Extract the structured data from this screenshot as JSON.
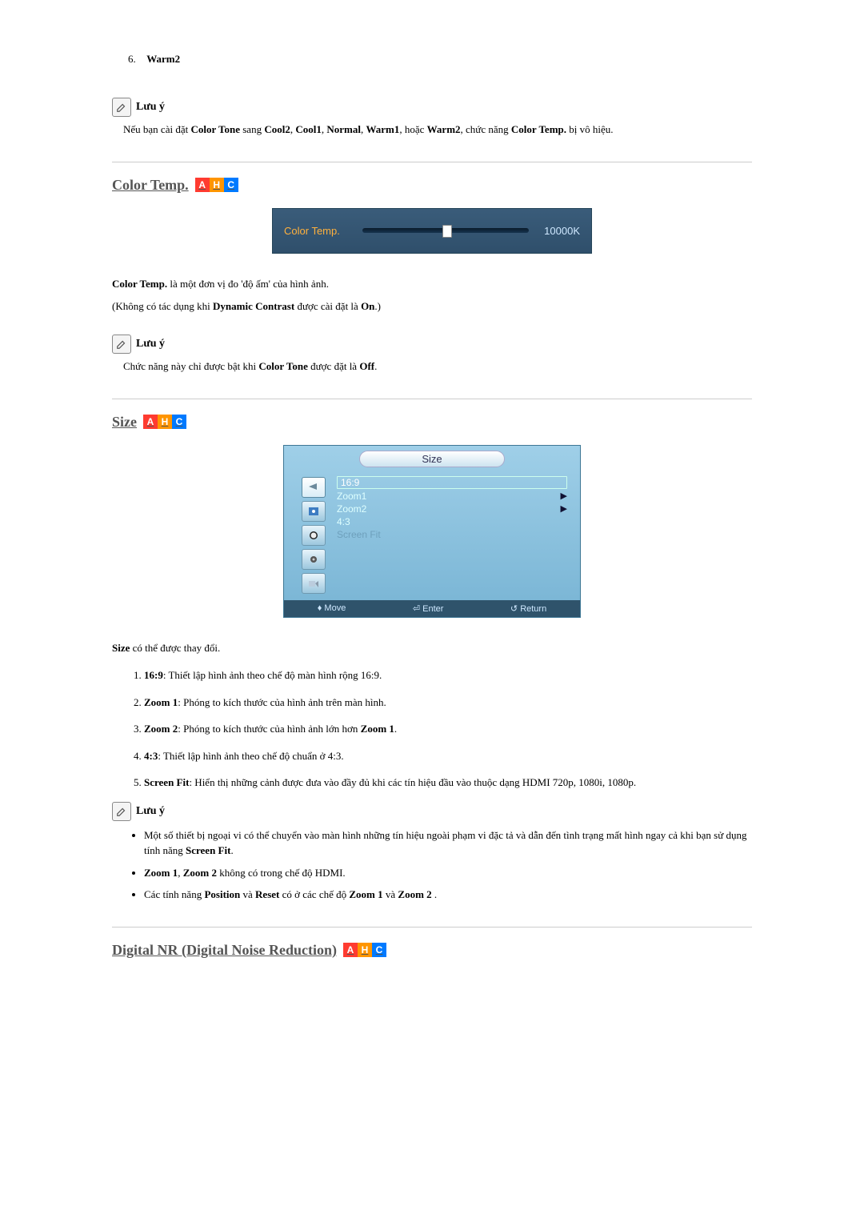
{
  "item6": {
    "number": "6.",
    "label": "Warm2"
  },
  "note_label": "Lưu ý",
  "note1_prefix": "Nếu bạn cài đặt ",
  "note1_b1": "Color Tone",
  "note1_mid1": " sang ",
  "note1_b2": "Cool2",
  "note1_c1": ", ",
  "note1_b3": "Cool1",
  "note1_c2": ", ",
  "note1_b4": "Normal",
  "note1_c3": ", ",
  "note1_b5": "Warm1",
  "note1_c4": ", hoặc ",
  "note1_b6": "Warm2",
  "note1_c5": ", chức năng ",
  "note1_b7": "Color Temp.",
  "note1_suffix": " bị vô hiệu.",
  "sec_colortemp": "Color Temp.",
  "badges": {
    "a": "A",
    "h": "H",
    "c": "C"
  },
  "slider": {
    "label": "Color Temp.",
    "value": "10000K"
  },
  "ct_desc_b": "Color Temp.",
  "ct_desc_t": " là một đơn vị đo 'độ ấm' của hình ảnh.",
  "ct_paren_a": "(Không có tác dụng khi ",
  "ct_paren_b1": "Dynamic Contrast",
  "ct_paren_m": " được cài đặt là ",
  "ct_paren_b2": "On",
  "ct_paren_z": ".)",
  "note2_a": "Chức năng này chỉ được bật khi ",
  "note2_b1": "Color Tone",
  "note2_m": " được đặt là ",
  "note2_b2": "Off",
  "note2_z": ".",
  "sec_size": "Size",
  "osd": {
    "tab": "Size",
    "rows": [
      "16:9",
      "Zoom1",
      "Zoom2",
      "4:3",
      "Screen Fit"
    ],
    "footer": {
      "move": "Move",
      "enter": "Enter",
      "return": "Return"
    }
  },
  "size_desc_b": "Size",
  "size_desc_t": " có thể được thay đổi.",
  "size_items": [
    {
      "b": "16:9",
      "t": ": Thiết lập hình ảnh theo chế độ màn hình rộng 16:9."
    },
    {
      "b": "Zoom 1",
      "t": ": Phóng to kích thước của hình ảnh trên màn hình."
    },
    {
      "b": "Zoom 2",
      "t": ": Phóng to kích thước của hình ảnh lớn hơn ",
      "b2": "Zoom 1",
      "t2": "."
    },
    {
      "b": "4:3",
      "t": ": Thiết lập hình ảnh theo chế độ chuẩn ở 4:3."
    },
    {
      "b": "Screen Fit",
      "t": ": Hiển thị những cảnh được đưa vào đầy đủ khi các tín hiệu đầu vào thuộc dạng HDMI 720p, 1080i, 1080p."
    }
  ],
  "note3_bullet1_a": "Một số thiết bị ngoại vi có thể chuyển vào màn hình những tín hiệu ngoài phạm vi đặc tả và dẫn đến tình trạng mất hình ngay cả khi bạn sử dụng tính năng ",
  "note3_bullet1_b": "Screen Fit",
  "note3_bullet1_z": ".",
  "note3_bullet2_b1": "Zoom 1",
  "note3_bullet2_c": ", ",
  "note3_bullet2_b2": "Zoom 2",
  "note3_bullet2_t": " không có trong chế độ HDMI.",
  "note3_bullet3_a": "Các tính năng ",
  "note3_bullet3_b1": "Position",
  "note3_bullet3_m1": " và ",
  "note3_bullet3_b2": "Reset",
  "note3_bullet3_m2": " có ở các chế độ ",
  "note3_bullet3_b3": "Zoom 1",
  "note3_bullet3_m3": " và ",
  "note3_bullet3_b4": "Zoom 2",
  "note3_bullet3_z": " .",
  "sec_dnr": "Digital NR (Digital Noise Reduction)"
}
